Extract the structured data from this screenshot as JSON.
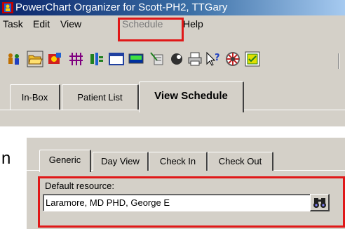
{
  "window": {
    "title": "PowerChart Organizer for Scott-PH2, TTGary"
  },
  "menu": {
    "items": [
      {
        "label": "Task",
        "disabled": false
      },
      {
        "label": "Edit",
        "disabled": false
      },
      {
        "label": "View",
        "disabled": false
      },
      {
        "label": "Schedule",
        "disabled": true
      },
      {
        "label": "Help",
        "disabled": false
      }
    ]
  },
  "toolbar": {
    "icons": [
      "people-icon",
      "open-folder-icon",
      "patient-chart-icon",
      "grid-icon",
      "tracking-icon",
      "calendar-icon",
      "monitor-icon",
      "notes-icon",
      "message-icon",
      "print-icon",
      "help-icon",
      "settings-icon",
      "document-icon"
    ]
  },
  "tabs": {
    "items": [
      "In-Box",
      "Patient List",
      "View Schedule"
    ],
    "active": "View Schedule"
  },
  "fragment": {
    "text": "n"
  },
  "dialog": {
    "tabs": [
      "Generic",
      "Day View",
      "Check In",
      "Check Out"
    ],
    "active_tab": "Generic",
    "resource_label": "Default resource:",
    "resource_value": "Laramore, MD PHD, George E",
    "lookup_icon": "binoculars-icon"
  },
  "colors": {
    "highlight": "#e01818",
    "title_bar_start": "#0a246a",
    "title_bar_end": "#a6caf0",
    "face": "#d4d0c8"
  }
}
